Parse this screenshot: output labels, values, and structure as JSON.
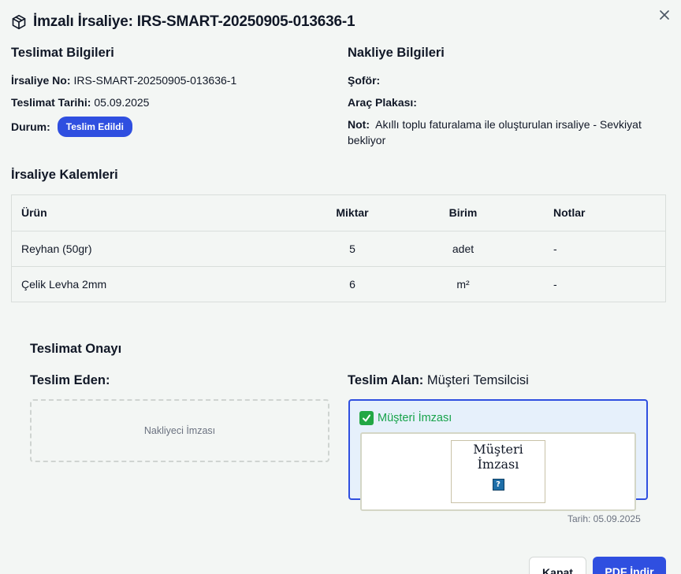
{
  "header": {
    "title": "İmzalı İrsaliye: IRS-SMART-20250905-013636-1",
    "icon": "package-icon",
    "close_icon": "close-icon"
  },
  "delivery_info": {
    "title": "Teslimat Bilgileri",
    "irsaliye_no_label": "İrsaliye No:",
    "irsaliye_no_value": "IRS-SMART-20250905-013636-1",
    "tarih_label": "Teslimat Tarihi:",
    "tarih_value": "05.09.2025",
    "durum_label": "Durum:",
    "durum_badge": "Teslim Edildi"
  },
  "shipping_info": {
    "title": "Nakliye Bilgileri",
    "sofor_label": "Şoför:",
    "sofor_value": "",
    "plaka_label": "Araç Plakası:",
    "plaka_value": "",
    "not_label": "Not:",
    "not_value": "Akıllı toplu faturalama ile oluşturulan irsaliye - Sevkiyat bekliyor"
  },
  "items": {
    "title": "İrsaliye Kalemleri",
    "columns": [
      "Ürün",
      "Miktar",
      "Birim",
      "Notlar"
    ],
    "rows": [
      [
        "Reyhan (50gr)",
        "5",
        "adet",
        "-"
      ],
      [
        "Çelik Levha 2mm",
        "6",
        "m²",
        "-"
      ]
    ]
  },
  "approval": {
    "title": "Teslimat Onayı",
    "eden_label": "Teslim Eden:",
    "eden_placeholder": "Nakliyeci İmzası",
    "alan_label": "Teslim Alan:",
    "alan_value": "Müşteri Temsilcisi",
    "alan_sig_title": "Müşteri İmzası",
    "sig_image_alt": "Müşteri İmzası",
    "tarih": "Tarih: 05.09.2025"
  },
  "footer": {
    "kapat": "Kapat",
    "pdf": "PDF İndir"
  },
  "colors": {
    "accent": "#2f4fe0",
    "success": "#17a34a",
    "background": "#f3f6f4"
  }
}
